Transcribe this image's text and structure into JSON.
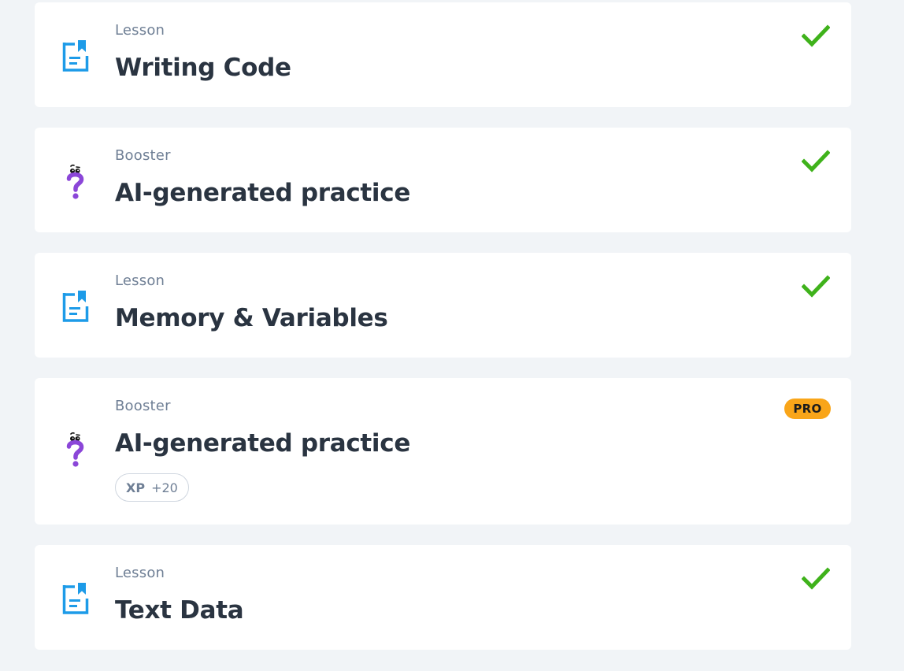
{
  "items": [
    {
      "type_label": "Lesson",
      "title": "Writing Code",
      "icon": "lesson-document-icon",
      "status": "completed"
    },
    {
      "type_label": "Booster",
      "title": "AI-generated practice",
      "icon": "booster-question-mark-icon",
      "status": "completed"
    },
    {
      "type_label": "Lesson",
      "title": "Memory & Variables",
      "icon": "lesson-document-icon",
      "status": "completed"
    },
    {
      "type_label": "Booster",
      "title": "AI-generated practice",
      "icon": "booster-question-mark-icon",
      "status": "locked-pro",
      "badge": "PRO",
      "xp": {
        "label": "XP",
        "value": "+20"
      }
    },
    {
      "type_label": "Lesson",
      "title": "Text Data",
      "icon": "lesson-document-icon",
      "status": "completed"
    }
  ],
  "colors": {
    "page_background": "#f1f4f7",
    "card_background": "#ffffff",
    "lesson_icon": "#1d9be8",
    "booster_icon": "#8b46d8",
    "check": "#3fb21b",
    "pro_badge": "#f9a519",
    "title_text": "#2a3441",
    "muted_text": "#6f7f95"
  }
}
